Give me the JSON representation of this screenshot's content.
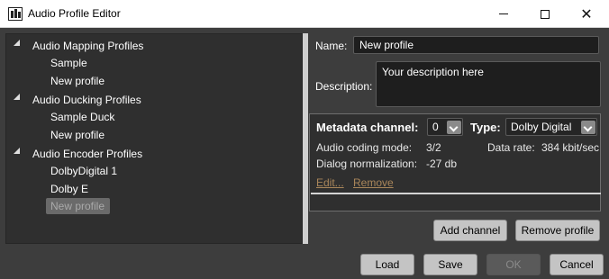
{
  "window": {
    "title": "Audio Profile Editor"
  },
  "tree": {
    "groups": [
      {
        "label": "Audio Mapping Profiles",
        "items": [
          "Sample",
          "New profile"
        ]
      },
      {
        "label": "Audio Ducking Profiles",
        "items": [
          "Sample Duck",
          "New profile"
        ]
      },
      {
        "label": "Audio Encoder Profiles",
        "items": [
          "DolbyDigital 1",
          "Dolby E",
          "New profile"
        ]
      }
    ],
    "selected": "New profile"
  },
  "profile": {
    "name_label": "Name:",
    "name_value": "New profile",
    "description_label": "Description:",
    "description_value": "Your description here"
  },
  "channel": {
    "metadata_label": "Metadata channel:",
    "metadata_value": "0",
    "type_label": "Type:",
    "type_value": "Dolby Digital",
    "coding_mode_label": "Audio coding mode:",
    "coding_mode_value": "3/2",
    "data_rate_label": "Data rate:",
    "data_rate_value": "384 kbit/sec",
    "dialog_norm_label": "Dialog normalization:",
    "dialog_norm_value": "-27 db",
    "edit_link": "Edit...",
    "remove_link": "Remove"
  },
  "actions": {
    "add_channel": "Add channel",
    "remove_profile": "Remove profile"
  },
  "footer": {
    "load": "Load",
    "save": "Save",
    "ok": "OK",
    "cancel": "Cancel"
  },
  "icons": {
    "app": "audio-profile-editor-icon",
    "minimize": "minimize-icon",
    "maximize": "maximize-icon",
    "close": "close-icon",
    "expand": "expanded-caret-icon",
    "dropdown": "chevron-down-icon"
  },
  "colors": {
    "background": "#3d3d3d",
    "panel": "#2f2f2f",
    "input": "#1e1e1e",
    "link": "#a9865a",
    "button": "#c4c4c4"
  }
}
